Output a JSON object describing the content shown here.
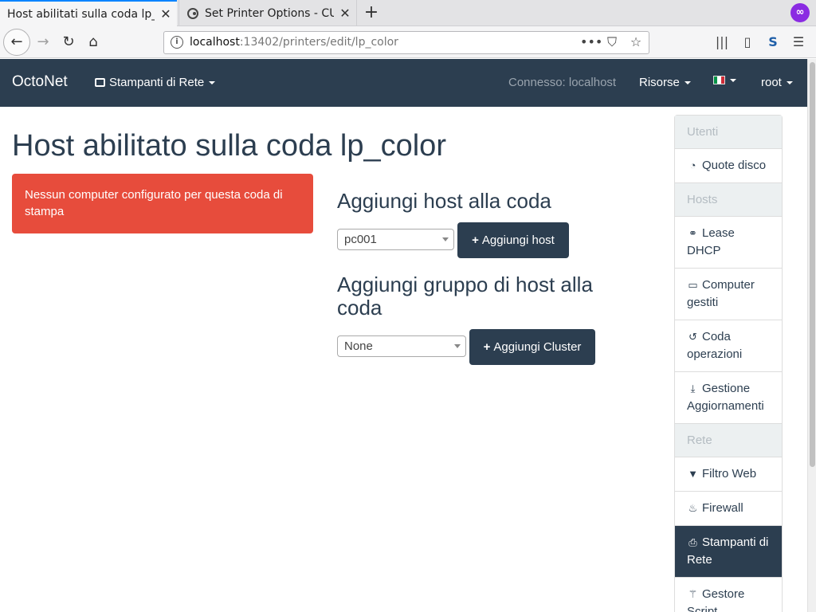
{
  "browser": {
    "tabs": [
      {
        "title": "Host abilitati sulla coda lp_c",
        "close": "✕"
      },
      {
        "title": "Set Printer Options - CUP",
        "close": "✕"
      }
    ],
    "newtab": "+",
    "url_host": "localhost",
    "url_rest": ":13402/printers/edit/lp_color",
    "icons": {
      "back": "←",
      "forward": "→",
      "reload": "↻",
      "home": "⌂",
      "more": "•••",
      "pocket": "⛉",
      "star": "☆",
      "library": "|||",
      "sidebar": "▯",
      "s_ext": "S",
      "menu": "☰",
      "mask": "∞",
      "info": "i"
    }
  },
  "topnav": {
    "brand": "OctoNet",
    "printers": "Stampanti di Rete",
    "connected": "Connesso: localhost",
    "resources": "Risorse",
    "user": "root",
    "flag_colors": [
      "#009246",
      "#ffffff",
      "#ce2b37"
    ]
  },
  "main": {
    "title": "Host abilitato sulla coda lp_color",
    "alert": "Nessun computer configurato per questa coda di stampa",
    "add_host_heading": "Aggiungi host alla coda",
    "host_select_value": "pc001",
    "add_host_button": "Aggiungi host",
    "add_group_heading": "Aggiungi gruppo di host alla coda",
    "cluster_select_value": "None",
    "add_cluster_button": "Aggiungi Cluster"
  },
  "sidebar": {
    "items": [
      {
        "label": "Utenti",
        "type": "header"
      },
      {
        "label": "Quote disco",
        "type": "link",
        "icon": "pie-chart"
      },
      {
        "label": "Hosts",
        "type": "header"
      },
      {
        "label": "Lease DHCP",
        "type": "link",
        "icon": "handshake"
      },
      {
        "label": "Computer gestiti",
        "type": "link",
        "icon": "desktop"
      },
      {
        "label": "Coda operazioni",
        "type": "link",
        "icon": "history"
      },
      {
        "label": "Gestione Aggiornamenti",
        "type": "link",
        "icon": "download"
      },
      {
        "label": "Rete",
        "type": "header"
      },
      {
        "label": "Filtro Web",
        "type": "link",
        "icon": "filter"
      },
      {
        "label": "Firewall",
        "type": "link",
        "icon": "fire"
      },
      {
        "label": "Stampanti di Rete",
        "type": "active",
        "icon": "print"
      },
      {
        "label": "Gestore Script",
        "type": "link",
        "icon": "magic"
      }
    ]
  },
  "colors": {
    "navbar": "#2c3e50",
    "alert": "#e74c3c",
    "sidebar_header": "#ecf0f1"
  }
}
